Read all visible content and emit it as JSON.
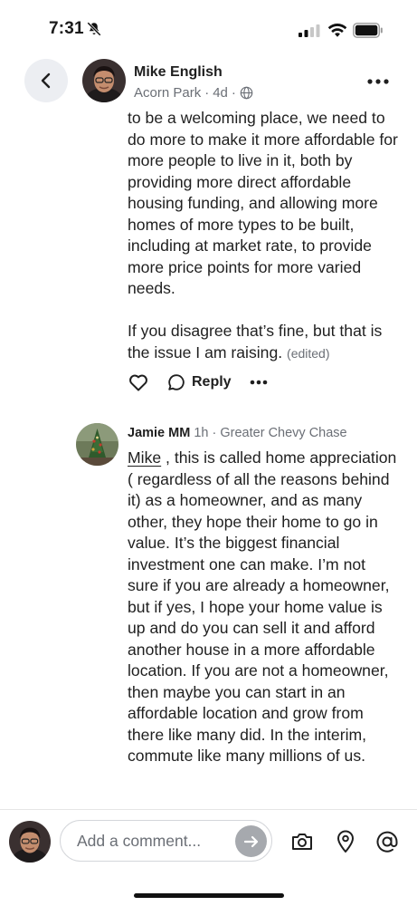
{
  "status_bar": {
    "time": "7:31"
  },
  "header": {
    "back_label": "Back",
    "author_name": "Mike English",
    "neighborhood": "Acorn Park",
    "age": "4d",
    "separator": "·"
  },
  "post": {
    "paragraph_1": "to be a welcoming place, we need to do more to make it more affordable for more people to live in it, both by providing more direct affordable housing funding, and allowing more homes of more types to be built, including at market rate, to provide more price points for more varied needs.",
    "paragraph_2": "If you disagree that’s fine,  but that is the issue I am raising.",
    "edited_label": "(edited)",
    "reply_label": "Reply"
  },
  "reply": {
    "author": "Jamie MM",
    "age": "1h",
    "separator": "·",
    "neighborhood": "Greater Chevy Chase",
    "mention": "Mike",
    "text": " , this is called home appreciation ( regardless of all the reasons behind it) as a homeowner, and as many other, they hope their home to go in value. It’s the biggest financial investment one can make. I’m not sure if you are already a homeowner, but if yes, I hope your home value is up and do you can sell it and afford another house in a more affordable location. If you are not a homeowner, then maybe you can start in an affordable location and grow from there like many did. In the interim, commute like many millions of us."
  },
  "composer": {
    "placeholder": "Add a comment..."
  },
  "colors": {
    "muted_text": "#6b6f76",
    "back_button_bg": "#eceef2",
    "send_button_bg": "#a6a9ae"
  },
  "icons": [
    "bell-off-icon",
    "signal-icon",
    "wifi-icon",
    "battery-icon",
    "chevron-left-icon",
    "globe-icon",
    "more-horizontal-icon",
    "heart-icon",
    "speech-bubble-icon",
    "arrow-right-icon",
    "camera-icon",
    "location-pin-icon",
    "at-sign-icon"
  ]
}
